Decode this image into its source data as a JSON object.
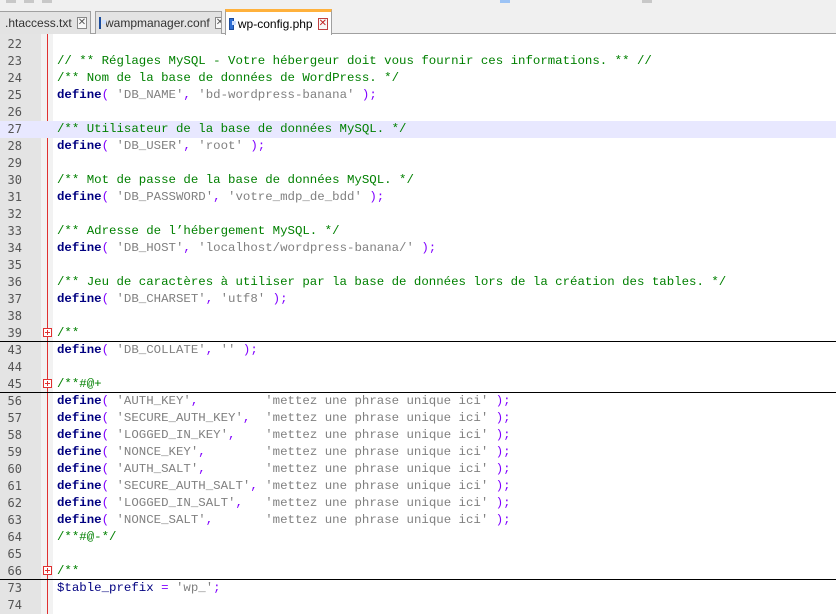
{
  "tabs": [
    {
      "label": ".htaccess.txt",
      "active": false
    },
    {
      "label": "wampmanager.conf",
      "active": false
    },
    {
      "label": "wp-config.php",
      "active": true
    }
  ],
  "editor": {
    "highlighted_line": "27",
    "lines": [
      {
        "num": "22",
        "tokens": []
      },
      {
        "num": "23",
        "tokens": [
          {
            "t": "// ** Réglages MySQL - Votre hébergeur doit vous fournir ces informations. ** //",
            "c": "cmt"
          }
        ]
      },
      {
        "num": "24",
        "tokens": [
          {
            "t": "/** Nom de la base de données de WordPress. */",
            "c": "cmt"
          }
        ]
      },
      {
        "num": "25",
        "tokens": [
          {
            "t": "define",
            "c": "kw"
          },
          {
            "t": "( ",
            "c": "op"
          },
          {
            "t": "'DB_NAME'",
            "c": "str"
          },
          {
            "t": ", ",
            "c": "op"
          },
          {
            "t": "'bd-wordpress-banana'",
            "c": "str"
          },
          {
            "t": " );",
            "c": "op"
          }
        ]
      },
      {
        "num": "26",
        "tokens": []
      },
      {
        "num": "27",
        "tokens": [
          {
            "t": "/** Utilisateur de la base de données MySQL. */",
            "c": "cmt"
          }
        ]
      },
      {
        "num": "28",
        "tokens": [
          {
            "t": "define",
            "c": "kw"
          },
          {
            "t": "( ",
            "c": "op"
          },
          {
            "t": "'DB_USER'",
            "c": "str"
          },
          {
            "t": ", ",
            "c": "op"
          },
          {
            "t": "'root'",
            "c": "str"
          },
          {
            "t": " );",
            "c": "op"
          }
        ]
      },
      {
        "num": "29",
        "tokens": []
      },
      {
        "num": "30",
        "tokens": [
          {
            "t": "/** Mot de passe de la base de données MySQL. */",
            "c": "cmt"
          }
        ]
      },
      {
        "num": "31",
        "tokens": [
          {
            "t": "define",
            "c": "kw"
          },
          {
            "t": "( ",
            "c": "op"
          },
          {
            "t": "'DB_PASSWORD'",
            "c": "str"
          },
          {
            "t": ", ",
            "c": "op"
          },
          {
            "t": "'votre_mdp_de_bdd'",
            "c": "str"
          },
          {
            "t": " );",
            "c": "op"
          }
        ]
      },
      {
        "num": "32",
        "tokens": []
      },
      {
        "num": "33",
        "tokens": [
          {
            "t": "/** Adresse de l’hébergement MySQL. */",
            "c": "cmt"
          }
        ]
      },
      {
        "num": "34",
        "tokens": [
          {
            "t": "define",
            "c": "kw"
          },
          {
            "t": "( ",
            "c": "op"
          },
          {
            "t": "'DB_HOST'",
            "c": "str"
          },
          {
            "t": ", ",
            "c": "op"
          },
          {
            "t": "'localhost/wordpress-banana/'",
            "c": "str"
          },
          {
            "t": " );",
            "c": "op"
          }
        ]
      },
      {
        "num": "35",
        "tokens": []
      },
      {
        "num": "36",
        "tokens": [
          {
            "t": "/** Jeu de caractères à utiliser par la base de données lors de la création des tables. */",
            "c": "cmt"
          }
        ]
      },
      {
        "num": "37",
        "tokens": [
          {
            "t": "define",
            "c": "kw"
          },
          {
            "t": "( ",
            "c": "op"
          },
          {
            "t": "'DB_CHARSET'",
            "c": "str"
          },
          {
            "t": ", ",
            "c": "op"
          },
          {
            "t": "'utf8'",
            "c": "str"
          },
          {
            "t": " );",
            "c": "op"
          }
        ]
      },
      {
        "num": "38",
        "tokens": []
      },
      {
        "num": "39",
        "folded": true,
        "tokens": [
          {
            "t": "/**",
            "c": "cmt"
          }
        ]
      },
      {
        "num": "43",
        "tokens": [
          {
            "t": "define",
            "c": "kw"
          },
          {
            "t": "( ",
            "c": "op"
          },
          {
            "t": "'DB_COLLATE'",
            "c": "str"
          },
          {
            "t": ", ",
            "c": "op"
          },
          {
            "t": "''",
            "c": "str"
          },
          {
            "t": " );",
            "c": "op"
          }
        ]
      },
      {
        "num": "44",
        "tokens": []
      },
      {
        "num": "45",
        "folded": true,
        "tokens": [
          {
            "t": "/**#@+",
            "c": "cmt"
          }
        ]
      },
      {
        "num": "56",
        "tokens": [
          {
            "t": "define",
            "c": "kw"
          },
          {
            "t": "( ",
            "c": "op"
          },
          {
            "t": "'AUTH_KEY'",
            "c": "str"
          },
          {
            "t": ",         ",
            "c": "op"
          },
          {
            "t": "'mettez une phrase unique ici'",
            "c": "str"
          },
          {
            "t": " );",
            "c": "op"
          }
        ]
      },
      {
        "num": "57",
        "tokens": [
          {
            "t": "define",
            "c": "kw"
          },
          {
            "t": "( ",
            "c": "op"
          },
          {
            "t": "'SECURE_AUTH_KEY'",
            "c": "str"
          },
          {
            "t": ",  ",
            "c": "op"
          },
          {
            "t": "'mettez une phrase unique ici'",
            "c": "str"
          },
          {
            "t": " );",
            "c": "op"
          }
        ]
      },
      {
        "num": "58",
        "tokens": [
          {
            "t": "define",
            "c": "kw"
          },
          {
            "t": "( ",
            "c": "op"
          },
          {
            "t": "'LOGGED_IN_KEY'",
            "c": "str"
          },
          {
            "t": ",    ",
            "c": "op"
          },
          {
            "t": "'mettez une phrase unique ici'",
            "c": "str"
          },
          {
            "t": " );",
            "c": "op"
          }
        ]
      },
      {
        "num": "59",
        "tokens": [
          {
            "t": "define",
            "c": "kw"
          },
          {
            "t": "( ",
            "c": "op"
          },
          {
            "t": "'NONCE_KEY'",
            "c": "str"
          },
          {
            "t": ",        ",
            "c": "op"
          },
          {
            "t": "'mettez une phrase unique ici'",
            "c": "str"
          },
          {
            "t": " );",
            "c": "op"
          }
        ]
      },
      {
        "num": "60",
        "tokens": [
          {
            "t": "define",
            "c": "kw"
          },
          {
            "t": "( ",
            "c": "op"
          },
          {
            "t": "'AUTH_SALT'",
            "c": "str"
          },
          {
            "t": ",        ",
            "c": "op"
          },
          {
            "t": "'mettez une phrase unique ici'",
            "c": "str"
          },
          {
            "t": " );",
            "c": "op"
          }
        ]
      },
      {
        "num": "61",
        "tokens": [
          {
            "t": "define",
            "c": "kw"
          },
          {
            "t": "( ",
            "c": "op"
          },
          {
            "t": "'SECURE_AUTH_SALT'",
            "c": "str"
          },
          {
            "t": ", ",
            "c": "op"
          },
          {
            "t": "'mettez une phrase unique ici'",
            "c": "str"
          },
          {
            "t": " );",
            "c": "op"
          }
        ]
      },
      {
        "num": "62",
        "tokens": [
          {
            "t": "define",
            "c": "kw"
          },
          {
            "t": "( ",
            "c": "op"
          },
          {
            "t": "'LOGGED_IN_SALT'",
            "c": "str"
          },
          {
            "t": ",   ",
            "c": "op"
          },
          {
            "t": "'mettez une phrase unique ici'",
            "c": "str"
          },
          {
            "t": " );",
            "c": "op"
          }
        ]
      },
      {
        "num": "63",
        "tokens": [
          {
            "t": "define",
            "c": "kw"
          },
          {
            "t": "( ",
            "c": "op"
          },
          {
            "t": "'NONCE_SALT'",
            "c": "str"
          },
          {
            "t": ",       ",
            "c": "op"
          },
          {
            "t": "'mettez une phrase unique ici'",
            "c": "str"
          },
          {
            "t": " );",
            "c": "op"
          }
        ]
      },
      {
        "num": "64",
        "tokens": [
          {
            "t": "/**#@-*/",
            "c": "cmt"
          }
        ]
      },
      {
        "num": "65",
        "tokens": []
      },
      {
        "num": "66",
        "folded": true,
        "tokens": [
          {
            "t": "/**",
            "c": "cmt"
          }
        ]
      },
      {
        "num": "73",
        "tokens": [
          {
            "t": "$table_prefix",
            "c": "var"
          },
          {
            "t": " = ",
            "c": "op"
          },
          {
            "t": "'wp_'",
            "c": "str"
          },
          {
            "t": ";",
            "c": "op"
          }
        ]
      },
      {
        "num": "74",
        "tokens": []
      }
    ]
  },
  "colors": {
    "comment": "#008000",
    "keyword": "#000080",
    "string": "#808080",
    "operator": "#8000ff",
    "active_tab_accent": "#ffb13c",
    "current_line": "#e8e8ff",
    "fold_marker": "#e03030"
  },
  "icons": {
    "tab_file": "php-file-icon",
    "tab_close": "close-icon",
    "fold": "fold-plus-icon"
  }
}
